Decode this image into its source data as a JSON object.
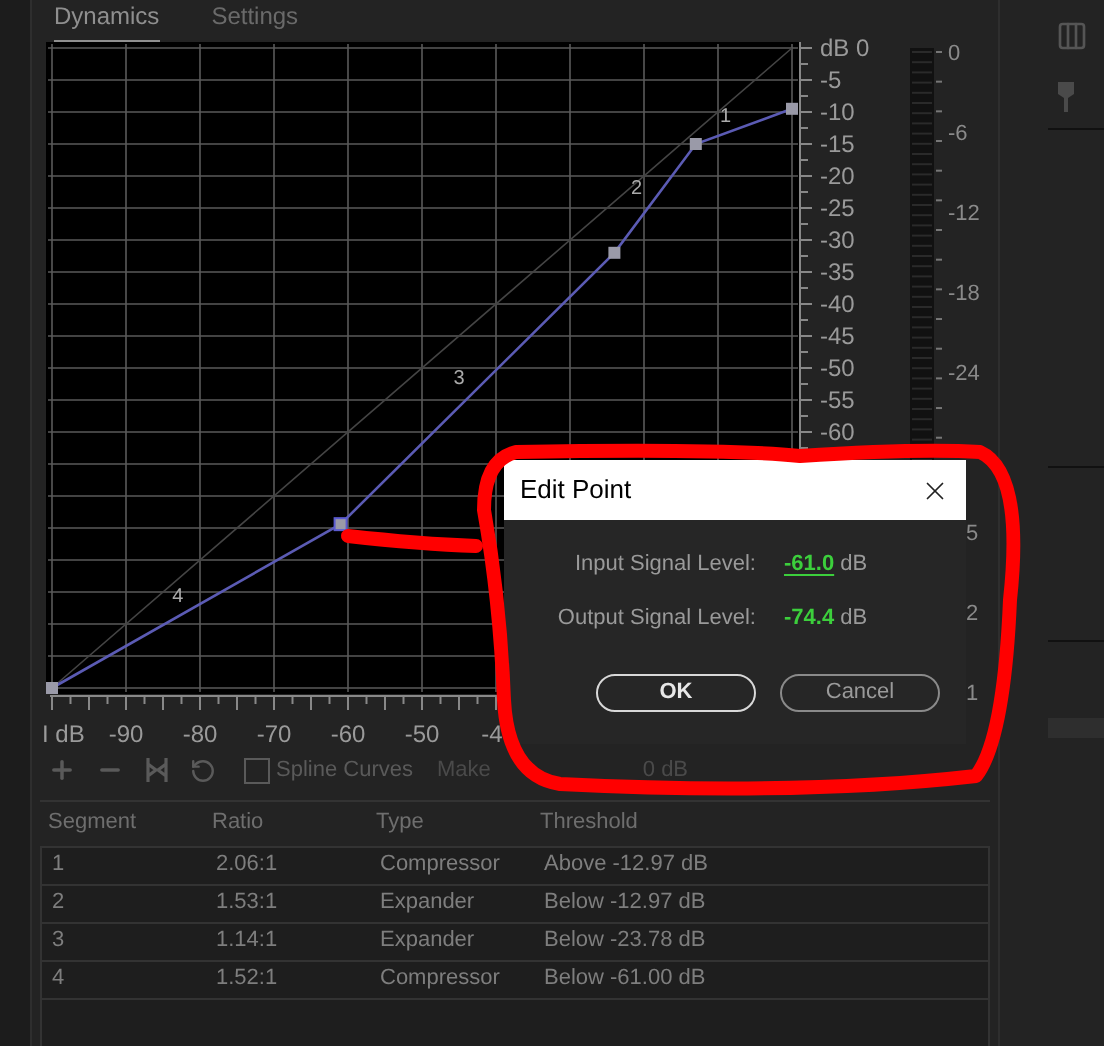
{
  "tabs": [
    {
      "label": "Dynamics",
      "selected": true
    },
    {
      "label": "Settings",
      "selected": false
    }
  ],
  "graph": {
    "chart_data": {
      "type": "line",
      "x": [
        -100,
        -61,
        -24,
        -13,
        0
      ],
      "series": [
        {
          "color": "#5b5bb4",
          "marker": true,
          "values": [
            -100,
            -74.4,
            -32,
            -15,
            -9.5
          ]
        },
        {
          "color": "#444444",
          "values": [
            -100,
            -61,
            -24,
            -13,
            0
          ]
        }
      ],
      "grid": true,
      "xlim": [
        -100,
        0
      ],
      "ylim": [
        -100,
        0
      ],
      "xticks": [
        {
          "value": -100,
          "label": "I dB"
        },
        -90,
        -80,
        -70,
        -60,
        -50
      ],
      "yticks": [
        {
          "value": 0,
          "label": "dB 0"
        },
        -5,
        -10,
        -15,
        -20,
        -25,
        -30,
        -35,
        -40,
        -45,
        -50,
        -55,
        -60
      ],
      "annotations": [
        "1",
        "2",
        "3",
        "4"
      ]
    },
    "cut_tick_label": "-4"
  },
  "meter": {
    "scale": [
      "0",
      "-6",
      "-12",
      "-18",
      "-24"
    ],
    "cut_scale": [
      "5",
      "2",
      "1"
    ]
  },
  "toolbar": {
    "spline_curves": {
      "label": "Spline Curves",
      "checked": false
    },
    "makeup_label": "Make",
    "makeup_value": "0 dB"
  },
  "table": {
    "columns": [
      "Segment",
      "Ratio",
      "Type",
      "Threshold"
    ],
    "rows": [
      [
        "1",
        "2.06:1",
        "Compressor",
        "Above -12.97 dB"
      ],
      [
        "2",
        "1.53:1",
        "Expander",
        "Below -12.97 dB"
      ],
      [
        "3",
        "1.14:1",
        "Expander",
        "Below -23.78 dB"
      ],
      [
        "4",
        "1.52:1",
        "Compressor",
        "Below -61.00 dB"
      ]
    ]
  },
  "dialog": {
    "title": "Edit Point",
    "fields": [
      {
        "label": "Input Signal Level:",
        "value": "-61.0",
        "unit": "dB",
        "focused": true
      },
      {
        "label": "Output Signal Level:",
        "value": "-74.4",
        "unit": "dB",
        "focused": false
      }
    ],
    "buttons": [
      {
        "label": "OK",
        "default": true
      },
      {
        "label": "Cancel",
        "default": false
      }
    ]
  }
}
